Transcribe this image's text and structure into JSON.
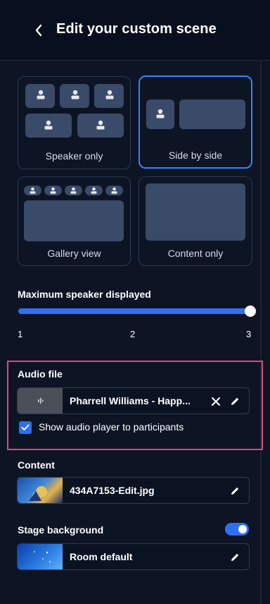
{
  "header": {
    "title": "Edit your custom scene"
  },
  "layouts": [
    {
      "id": "speaker-only",
      "label": "Speaker only",
      "selected": false
    },
    {
      "id": "side-by-side",
      "label": "Side by side",
      "selected": true
    },
    {
      "id": "gallery-view",
      "label": "Gallery view",
      "selected": false
    },
    {
      "id": "content-only",
      "label": "Content only",
      "selected": false
    }
  ],
  "speakers": {
    "label": "Maximum speaker displayed",
    "ticks": [
      "1",
      "2",
      "3"
    ],
    "value": 3,
    "min": 1,
    "max": 3
  },
  "audio": {
    "label": "Audio file",
    "file_name": "Pharrell Williams - Happ...",
    "show_player_label": "Show audio player to participants",
    "show_player_checked": true
  },
  "content": {
    "label": "Content",
    "file_name": "434A7153-Edit.jpg"
  },
  "stage": {
    "label": "Stage background",
    "enabled": true,
    "value": "Room default"
  },
  "colors": {
    "background": "#0d1524",
    "accent": "#2f6ff2",
    "highlight_border": "#e0467c",
    "tile": "#3a4a69"
  }
}
